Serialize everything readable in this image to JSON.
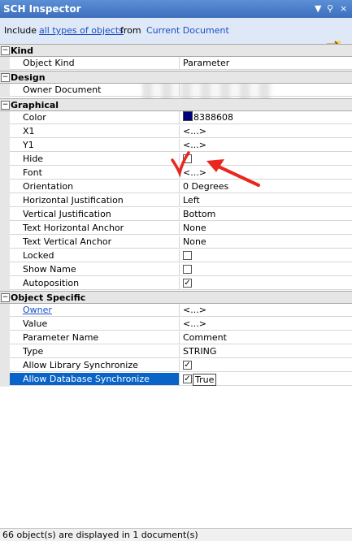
{
  "window": {
    "title": "SCH Inspector",
    "controls": [
      "▼",
      "⚲",
      "×"
    ]
  },
  "include_bar": {
    "prefix": "Include",
    "filter_link": "all types of objects",
    "middle": "from",
    "scope_link": "Current Document",
    "wand_icon": "magic-wand-icon"
  },
  "categories": {
    "kind": {
      "label": "Kind",
      "toggle": "−",
      "rows": [
        {
          "name": "Object Kind",
          "value": "Parameter"
        }
      ]
    },
    "design": {
      "label": "Design",
      "toggle": "−",
      "rows": [
        {
          "name": "Owner Document",
          "value": ""
        }
      ]
    },
    "graphical": {
      "label": "Graphical",
      "toggle": "−",
      "rows": [
        {
          "name": "Color",
          "value": "8388608",
          "swatch": "#00007f"
        },
        {
          "name": "X1",
          "value": "<...>"
        },
        {
          "name": "Y1",
          "value": "<...>"
        },
        {
          "name": "Hide",
          "checked": false
        },
        {
          "name": "Font",
          "value": "<...>"
        },
        {
          "name": "Orientation",
          "value": "0 Degrees"
        },
        {
          "name": "Horizontal Justification",
          "value": "Left"
        },
        {
          "name": "Vertical Justification",
          "value": "Bottom"
        },
        {
          "name": "Text Horizontal Anchor",
          "value": "None"
        },
        {
          "name": "Text Vertical Anchor",
          "value": "None"
        },
        {
          "name": "Locked",
          "checked": false
        },
        {
          "name": "Show Name",
          "checked": false
        },
        {
          "name": "Autoposition",
          "checked": true
        }
      ]
    },
    "object_specific": {
      "label": "Object Specific",
      "toggle": "−",
      "rows": [
        {
          "name": "Owner",
          "value": "<...>"
        },
        {
          "name": "Value",
          "value": "<...>"
        },
        {
          "name": "Parameter Name",
          "value": "Comment"
        },
        {
          "name": "Type",
          "value": "STRING"
        },
        {
          "name": "Allow Library Synchronize",
          "checked": true
        },
        {
          "name": "Allow Database Synchronize",
          "checked": true,
          "text": "True"
        }
      ]
    }
  },
  "checkmark": "✓",
  "status": "66 object(s) are displayed in 1 document(s)",
  "annotation_color": "#e8281e"
}
